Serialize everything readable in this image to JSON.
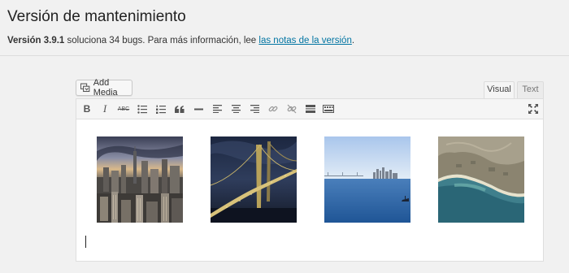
{
  "header": {
    "title": "Versión de mantenimiento"
  },
  "notice": {
    "version": "Versión 3.9.1",
    "text_before_link": " soluciona 34 bugs. Para más información, lee ",
    "link_text": "las notas de la versión",
    "text_after_link": "."
  },
  "editor": {
    "add_media_label": "Add Media",
    "tabs": [
      "Visual",
      "Text"
    ],
    "active_tab": "Visual",
    "toolbar_buttons": [
      {
        "name": "bold",
        "glyph": "B"
      },
      {
        "name": "italic",
        "glyph": "I"
      },
      {
        "name": "strikethrough",
        "glyph": "ABC"
      },
      {
        "name": "bulleted-list"
      },
      {
        "name": "numbered-list"
      },
      {
        "name": "blockquote"
      },
      {
        "name": "horizontal-line"
      },
      {
        "name": "align-left"
      },
      {
        "name": "align-center"
      },
      {
        "name": "align-right"
      },
      {
        "name": "insert-link"
      },
      {
        "name": "remove-link"
      },
      {
        "name": "insert-more"
      },
      {
        "name": "toolbar-toggle"
      },
      {
        "name": "fullscreen"
      }
    ],
    "gallery_images": [
      "city-skyline-photo",
      "bridge-night-photo",
      "bay-skyline-photo",
      "coastline-aerial-photo"
    ]
  }
}
